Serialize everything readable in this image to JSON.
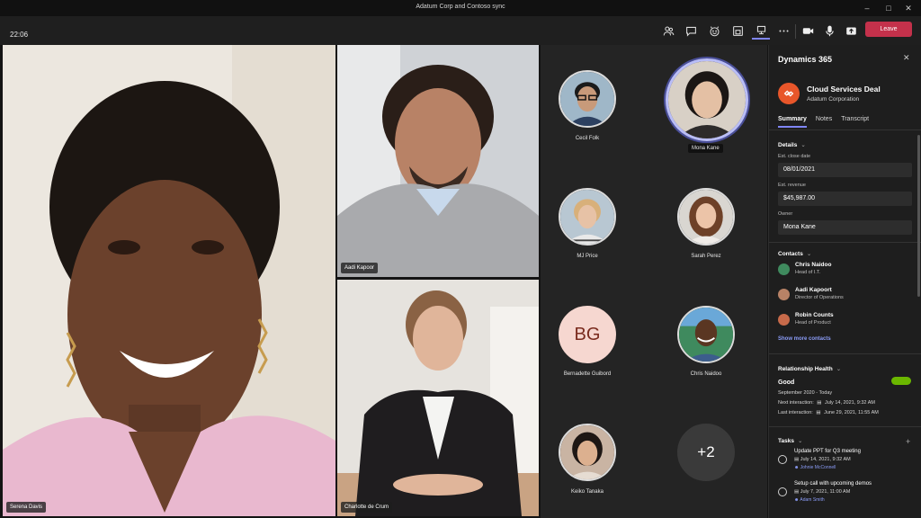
{
  "window": {
    "title": "Adatum Corp and Contoso sync"
  },
  "toolbar": {
    "clock": "22:06",
    "leave_label": "Leave"
  },
  "video": {
    "tiles": [
      {
        "name": "Serena Davis"
      },
      {
        "name": "Aadi Kapoor"
      },
      {
        "name": "Charlotte de Crum"
      }
    ]
  },
  "gallery": {
    "participants": [
      {
        "name": "Cecil Folk"
      },
      {
        "name": "Mona Kane"
      },
      {
        "name": "MJ Price"
      },
      {
        "name": "Sarah Perez"
      },
      {
        "name": "Bernadette Guibord",
        "initials": "BG"
      },
      {
        "name": "Chris Naidoo"
      },
      {
        "name": "Keiko Tanaka"
      }
    ],
    "overflow": "+2"
  },
  "panel": {
    "title": "Dynamics 365",
    "deal": {
      "title": "Cloud Services Deal",
      "company": "Adatum Corporation"
    },
    "tabs": [
      "Summary",
      "Notes",
      "Transcript"
    ],
    "details": {
      "heading": "Details",
      "close_label": "Est. close date",
      "close_value": "08/01/2021",
      "revenue_label": "Est. revenue",
      "revenue_value": "$45,987.00",
      "owner_label": "Owner",
      "owner_value": "Mona Kane"
    },
    "contacts": {
      "heading": "Contacts",
      "items": [
        {
          "name": "Chris Naidoo",
          "role": "Head of I.T."
        },
        {
          "name": "Aadi Kapoort",
          "role": "Director of Operations"
        },
        {
          "name": "Robin Counts",
          "role": "Head of Product"
        }
      ],
      "more": "Show more contacts"
    },
    "health": {
      "heading": "Relationship Health",
      "status": "Good",
      "period": "September 2020 - Today",
      "next_label": "Next interaction:",
      "next_value": "July 14, 2021, 9:32 AM",
      "last_label": "Last interaction:",
      "last_value": "June 29, 2021, 11:55 AM"
    },
    "tasks": {
      "heading": "Tasks",
      "items": [
        {
          "title": "Update PPT for Q3 meeting",
          "date": "July 14, 2021, 9:32 AM",
          "owner": "Johnie McConnell"
        },
        {
          "title": "Setup call with upcoming demos",
          "date": "July 7, 2021, 11:00 AM",
          "owner": "Adam Smith"
        }
      ]
    }
  }
}
